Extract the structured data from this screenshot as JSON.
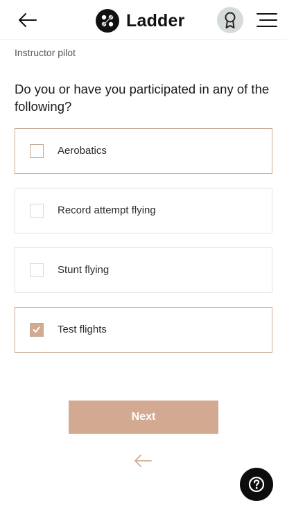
{
  "header": {
    "brand_name": "Ladder",
    "icons": {
      "back": "arrow-left-icon",
      "logo": "ladder-logo-icon",
      "badge": "award-ribbon-icon",
      "menu": "hamburger-menu-icon"
    }
  },
  "section_label": "Instructor pilot",
  "question": "Do you or have you participated in any of the following?",
  "options": [
    {
      "label": "Aerobatics",
      "checked": false,
      "focused": true
    },
    {
      "label": "Record attempt flying",
      "checked": false,
      "focused": false
    },
    {
      "label": "Stunt flying",
      "checked": false,
      "focused": false
    },
    {
      "label": "Test flights",
      "checked": true,
      "focused": true
    }
  ],
  "next_label": "Next",
  "colors": {
    "accent": "#d3aa91",
    "option_border": "#e2e2e2",
    "selected_border": "#c5a994",
    "text": "#1a1a1a"
  }
}
